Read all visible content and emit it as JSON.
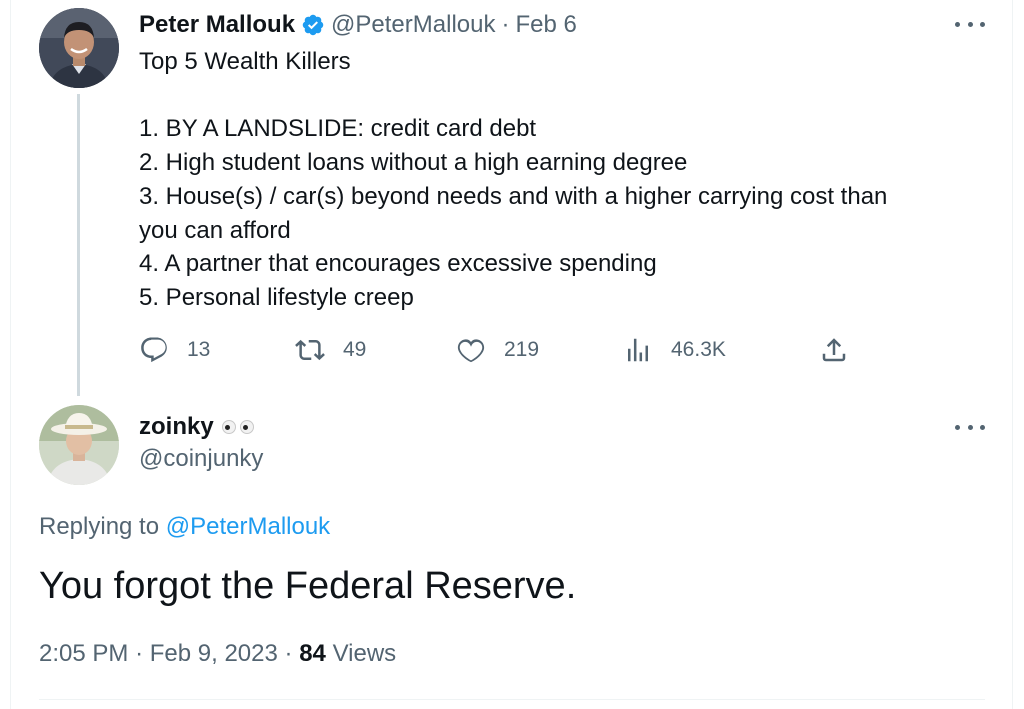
{
  "parent_tweet": {
    "display_name": "Peter Mallouk",
    "verified": true,
    "handle": "@PeterMallouk",
    "separator": "·",
    "date": "Feb 6",
    "title": "Top 5 Wealth Killers",
    "lines": [
      "1. BY A LANDSLIDE: credit card debt",
      "2. High student loans without a high earning degree",
      "3. House(s) / car(s) beyond needs and with a higher carrying cost than",
      "you can afford",
      "4. A partner that encourages excessive spending",
      "5. Personal lifestyle creep"
    ],
    "actions": {
      "replies": "13",
      "retweets": "49",
      "likes": "219",
      "views": "46.3K"
    }
  },
  "reply_tweet": {
    "display_name": "zoinky",
    "emoji": "eyes-emoji",
    "handle": "@coinjunky",
    "replying_prefix": "Replying to",
    "replying_to": "@PeterMallouk",
    "text": "You forgot the Federal Reserve.",
    "time": "2:05 PM",
    "separator": "·",
    "date": "Feb 9, 2023",
    "views_count": "84",
    "views_label": "Views"
  },
  "colors": {
    "text_primary": "#0f1419",
    "text_secondary": "#536471",
    "accent": "#1d9bf0",
    "thread_line": "#cfd9de",
    "divider": "#eff3f4"
  }
}
